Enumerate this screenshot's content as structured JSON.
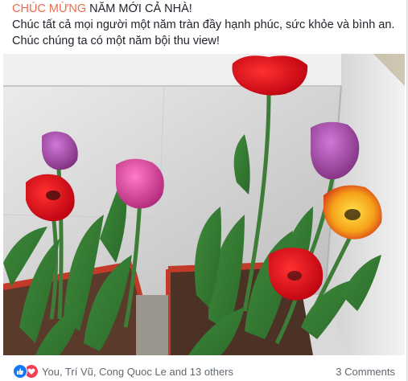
{
  "post": {
    "line1_highlight": "CHÚC MỪNG",
    "line1_rest": " NĂM MỚI CẢ NHÀ!",
    "line2": "Chúc tất cả mọi người một năm tràn đầy hạnh phúc, sức khỏe và bình an.",
    "line3": "Chúc chúng ta có một năm bội thu view!",
    "highlight_color": "#f26a4b"
  },
  "photo": {
    "subject": "tulips-in-planter"
  },
  "footer": {
    "reaction_icons": [
      "like-icon",
      "love-icon"
    ],
    "reactors_text": "You, Trí Vũ, Cong Quoc Le and 13 others",
    "comments_text": "3 Comments",
    "like_color": "#1877f2",
    "love_color": "#f33e58"
  }
}
